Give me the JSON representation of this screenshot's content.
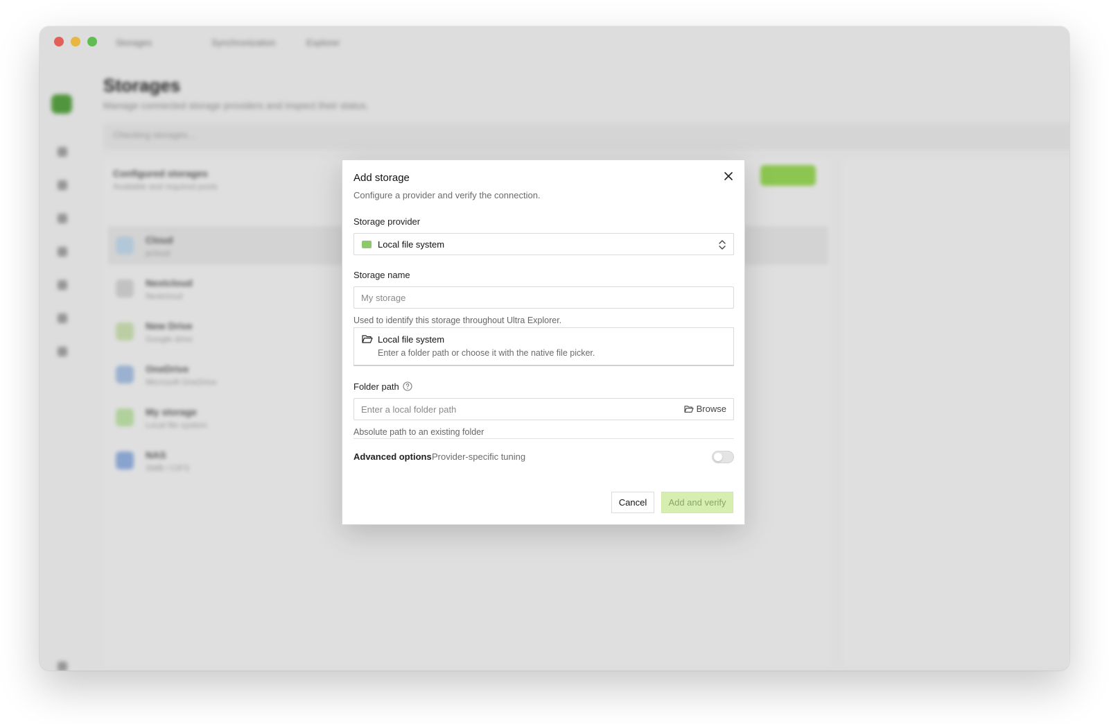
{
  "window": {
    "tabs": [
      "Storages",
      "Synchronization",
      "Explorer"
    ],
    "page_title": "Storages",
    "page_subtitle": "Manage connected storage providers and inspect their status.",
    "banner_text": "Checking storages…"
  },
  "storage_list": {
    "title": "Configured storages",
    "subtitle": "Available and required pools",
    "items": [
      {
        "name": "Cloud",
        "sub": "pcloud"
      },
      {
        "name": "Nextcloud",
        "sub": "Nextcloud"
      },
      {
        "name": "New Drive",
        "sub": "Google drive"
      },
      {
        "name": "OneDrive",
        "sub": "Microsoft OneDrive"
      },
      {
        "name": "My storage",
        "sub": "Local file system"
      },
      {
        "name": "NAS",
        "sub": "SMB / CIFS"
      }
    ]
  },
  "modal": {
    "title": "Add storage",
    "subtitle": "Configure a provider and verify the connection.",
    "provider_label": "Storage provider",
    "provider_value": "Local file system",
    "name_label": "Storage name",
    "name_placeholder": "My storage",
    "name_hint": "Used to identify this storage throughout Ultra Explorer.",
    "card_title": "Local file system",
    "card_subtitle": "Enter a folder path or choose it with the native file picker.",
    "folder_label": "Folder path",
    "folder_placeholder": "Enter a local folder path",
    "browse_label": "Browse",
    "folder_hint": "Absolute path to an existing folder",
    "advanced_label": "Advanced options",
    "advanced_sub": "Provider-specific tuning",
    "advanced_enabled": false,
    "cancel_label": "Cancel",
    "submit_label": "Add and verify"
  },
  "colors": {
    "accent": "#8fcd4d",
    "primary_disabled_bg": "#d6efb0",
    "primary_disabled_text": "#8aa56a"
  }
}
